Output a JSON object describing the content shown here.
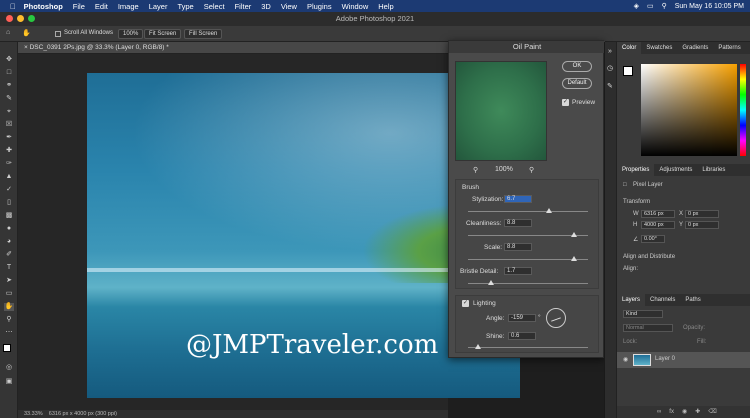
{
  "menubar": {
    "app_name": "Photoshop",
    "items": [
      "File",
      "Edit",
      "Image",
      "Layer",
      "Type",
      "Select",
      "Filter",
      "3D",
      "View",
      "Plugins",
      "Window",
      "Help"
    ],
    "clock": "Sun May 16  10:05 PM"
  },
  "window": {
    "title": "Adobe Photoshop 2021"
  },
  "options": {
    "scroll_all_label": "Scroll All Windows",
    "zoom_value": "100%",
    "fit_screen_label": "Fit Screen",
    "fill_screen_label": "Fill Screen"
  },
  "document": {
    "tab_label": "DSC_0391 2Ps.jpg @ 33.3% (Layer 0, RGB/8) *",
    "watermark": "@JMPTraveler.com",
    "status_zoom": "33.33%",
    "status_size": "6316 px x 4000 px (300 ppi)"
  },
  "dialog": {
    "title": "Oil Paint",
    "ok_label": "OK",
    "default_label": "Default",
    "preview_label": "Preview",
    "preview_checked": true,
    "zoom_value": "100%",
    "brush_header": "Brush",
    "stylization_label": "Stylization:",
    "stylization_value": "6.7",
    "stylization_level": 0.67,
    "cleanliness_label": "Cleanliness:",
    "cleanliness_value": "8.8",
    "cleanliness_level": 0.88,
    "scale_label": "Scale:",
    "scale_value": "8.8",
    "scale_level": 0.88,
    "bristle_label": "Bristle Detail:",
    "bristle_value": "1.7",
    "bristle_level": 0.17,
    "lighting_label": "Lighting",
    "lighting_checked": true,
    "angle_label": "Angle:",
    "angle_value": "-159",
    "angle_unit": "°",
    "shine_label": "Shine:",
    "shine_value": "0.6",
    "shine_level": 0.06
  },
  "panels": {
    "color_tabs": [
      "Color",
      "Swatches",
      "Gradients",
      "Patterns"
    ],
    "props_tabs": [
      "Properties",
      "Adjustments",
      "Libraries"
    ],
    "pixel_layer_label": "Pixel Layer",
    "transform_header": "Transform",
    "w_value": "6316 px",
    "x_value": "0 px",
    "h_value": "4000 px",
    "y_value": "0 px",
    "angle_value": "0.00°",
    "align_header": "Align and Distribute",
    "align_label": "Align:",
    "layers_tabs": [
      "Layers",
      "Channels",
      "Paths"
    ],
    "kind_label": "Kind",
    "blend_mode": "Normal",
    "opacity_label": "Opacity:",
    "lock_label": "Lock:",
    "fill_label": "Fill:",
    "layer_name": "Layer 0"
  },
  "colors": {
    "menubar": "#1c3a73",
    "accent_blue": "#2f65b8",
    "hue_bar": "rainbow"
  }
}
